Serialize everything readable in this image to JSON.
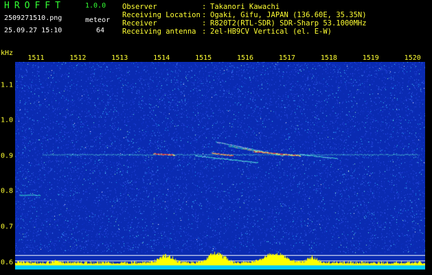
{
  "header": {
    "app_title": "HROFFT",
    "app_version": "1.0.0",
    "file_name": "2509271510.png",
    "date_time": "25.09.27 15:10",
    "meteor_label": "meteor",
    "meteor_count": "64"
  },
  "station_info": [
    {
      "key": "Observer",
      "value": "Takanori Kawachi"
    },
    {
      "key": "Receiving Location",
      "value": "Ogaki, Gifu, JAPAN (136.60E, 35.35N)"
    },
    {
      "key": "Receiver",
      "value": "R820T2(RTL-SDR) SDR-Sharp 53.1000MHz"
    },
    {
      "key": "Receiving antenna",
      "value": "2el-HB9CV Vertical (el. E-W)"
    }
  ],
  "info_separator": ":",
  "y_axis": {
    "unit": "kHz",
    "ticks": [
      "1.1",
      "1.0",
      "0.9",
      "0.8",
      "0.7",
      "0.6"
    ],
    "range": [
      0.58,
      1.165
    ]
  },
  "x_axis": {
    "ticks": [
      "1511",
      "1512",
      "1513",
      "1514",
      "1515",
      "1516",
      "1517",
      "1518",
      "1519",
      "1520"
    ],
    "range": [
      1510.5,
      1520.3
    ]
  },
  "colors": {
    "background": "#000000",
    "spectrogram_bg": "#0a2bb2",
    "axis_text": "#ffff33",
    "title_text": "#33ff33",
    "signal_hot": "#ff3333",
    "signal_warm": "#ffff66",
    "signal_cool": "#33ffcc",
    "activity_bar": "#ffff00",
    "activity_base": "#00ccff",
    "reference_line": "#ffffff"
  },
  "signal": {
    "carrier_freq_khz": 0.905,
    "reference_lines_khz": [
      0.62,
      0.605
    ]
  }
}
